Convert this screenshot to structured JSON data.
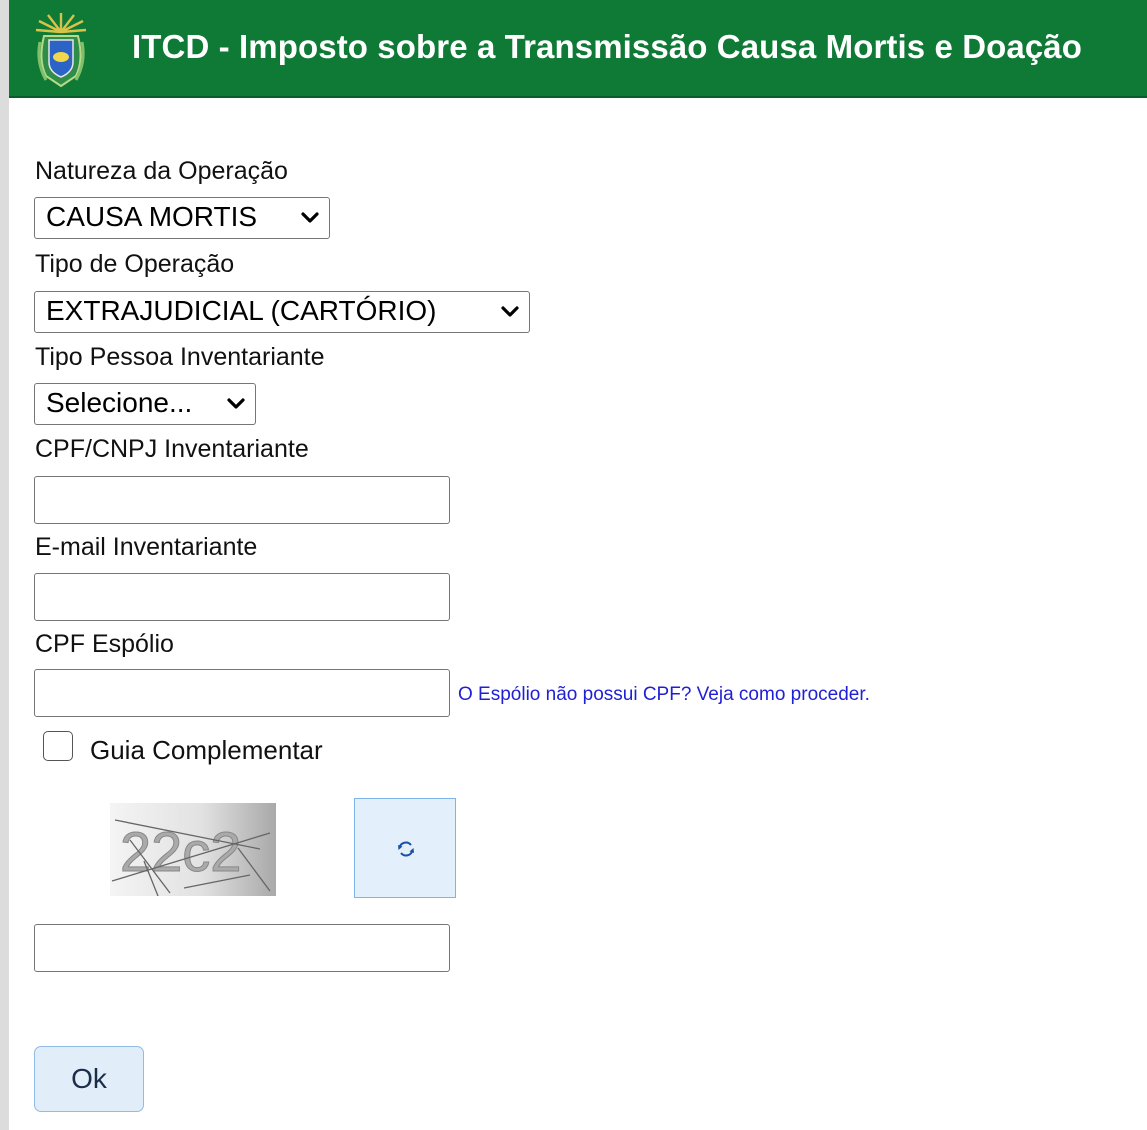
{
  "header": {
    "title": "ITCD - Imposto sobre a Transmissão Causa Mortis e Doação",
    "background_color": "#0e7a35",
    "logo_icon": "state-coat-of-arms-icon"
  },
  "form": {
    "natureza": {
      "label": "Natureza da Operação",
      "value": "CAUSA MORTIS"
    },
    "tipo_operacao": {
      "label": "Tipo de Operação",
      "value": "EXTRAJUDICIAL (CARTÓRIO)"
    },
    "tipo_pessoa": {
      "label": "Tipo Pessoa Inventariante",
      "value": "Selecione..."
    },
    "cpf_cnpj": {
      "label": "CPF/CNPJ Inventariante",
      "value": ""
    },
    "email": {
      "label": "E-mail Inventariante",
      "value": ""
    },
    "cpf_espolio": {
      "label": "CPF Espólio",
      "value": "",
      "help_link": "O Espólio não possui CPF? Veja como proceder."
    },
    "guia_complementar": {
      "label": "Guia Complementar",
      "checked": false
    },
    "captcha": {
      "text": "22c2",
      "refresh_icon": "refresh-icon",
      "input_value": ""
    },
    "submit_label": "Ok"
  }
}
